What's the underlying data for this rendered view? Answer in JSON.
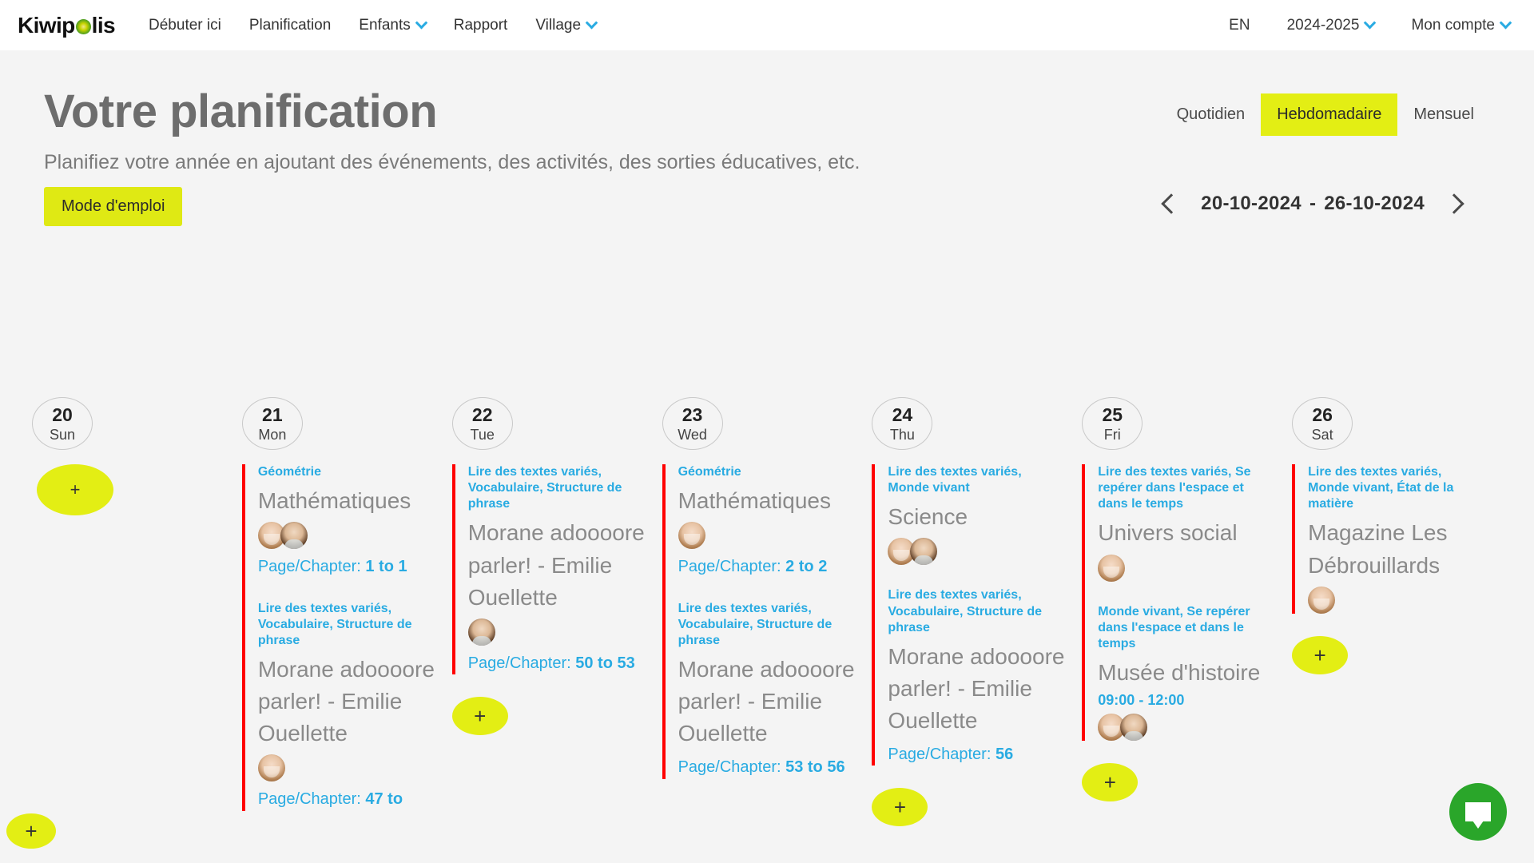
{
  "nav": {
    "brand_pre": "Kiwip",
    "brand_post": "lis",
    "links": [
      {
        "label": "Débuter ici",
        "caret": false
      },
      {
        "label": "Planification",
        "caret": false
      },
      {
        "label": "Enfants",
        "caret": true
      },
      {
        "label": "Rapport",
        "caret": false
      },
      {
        "label": "Village",
        "caret": true
      }
    ],
    "language": "EN",
    "school_year": "2024-2025",
    "account": "Mon compte"
  },
  "header": {
    "title": "Votre planification",
    "subtitle": "Planifiez votre année en ajoutant des événements, des activités, des sorties éducatives, etc.",
    "howto_button": "Mode d'emploi"
  },
  "view_tabs": [
    {
      "label": "Quotidien",
      "active": false
    },
    {
      "label": "Hebdomadaire",
      "active": true
    },
    {
      "label": "Mensuel",
      "active": false
    }
  ],
  "date_nav": {
    "start": "20-10-2024",
    "separator": "-",
    "end": "26-10-2024",
    "prev_label": "‹",
    "next_label": "›"
  },
  "add_label": "+",
  "colors": {
    "accent_yellow": "#e3ee14",
    "link_blue": "#29abe2",
    "event_bar_red": "#ff0000",
    "chat_green": "#2aa62a",
    "title_grey": "#6d6d6d"
  },
  "days": [
    {
      "num": "20",
      "name": "Sun",
      "events": [],
      "add_button": true
    },
    {
      "num": "21",
      "name": "Mon",
      "events": [
        {
          "tags": "Géométrie",
          "title": "Mathématiques",
          "avatars": [
            "girl",
            "boy"
          ],
          "page": "Page/Chapter: ",
          "page_value": "1 to 1",
          "time": ""
        },
        {
          "tags": "Lire des textes variés, Vocabulaire, Structure de phrase",
          "title": "Morane adoooore parler! - Emilie Ouellette",
          "avatars": [
            "girl"
          ],
          "page": "Page/Chapter: ",
          "page_value": "47 to",
          "time": ""
        }
      ],
      "add_button": false
    },
    {
      "num": "22",
      "name": "Tue",
      "events": [
        {
          "tags": "Lire des textes variés, Vocabulaire, Structure de phrase",
          "title": "Morane adoooore parler! - Emilie Ouellette",
          "avatars": [
            "boy"
          ],
          "page": "Page/Chapter: ",
          "page_value": "50 to 53",
          "time": ""
        }
      ],
      "add_button": true
    },
    {
      "num": "23",
      "name": "Wed",
      "events": [
        {
          "tags": "Géométrie",
          "title": "Mathématiques",
          "avatars": [
            "girl"
          ],
          "page": "Page/Chapter: ",
          "page_value": "2 to 2",
          "time": ""
        },
        {
          "tags": "Lire des textes variés, Vocabulaire, Structure de phrase",
          "title": "Morane adoooore parler! - Emilie Ouellette",
          "avatars": [],
          "page": "Page/Chapter: ",
          "page_value": "53 to 56",
          "time": ""
        }
      ],
      "add_button": false
    },
    {
      "num": "24",
      "name": "Thu",
      "events": [
        {
          "tags": "Lire des textes variés, Monde vivant",
          "title": "Science",
          "avatars": [
            "girl",
            "boy"
          ],
          "page": "",
          "page_value": "",
          "time": ""
        },
        {
          "tags": "Lire des textes variés, Vocabulaire, Structure de phrase",
          "title": "Morane adoooore parler! - Emilie Ouellette",
          "avatars": [],
          "page": "Page/Chapter: ",
          "page_value": "56",
          "time": ""
        }
      ],
      "add_button": true
    },
    {
      "num": "25",
      "name": "Fri",
      "events": [
        {
          "tags": "Lire des textes variés, Se repérer dans l'espace et dans le temps",
          "title": "Univers social",
          "avatars": [
            "girl"
          ],
          "page": "",
          "page_value": "",
          "time": ""
        },
        {
          "tags": "Monde vivant, Se repérer dans l'espace et dans le temps",
          "title": "Musée d'histoire",
          "avatars": [
            "girl",
            "boy"
          ],
          "page": "",
          "page_value": "",
          "time": "09:00 - 12:00"
        }
      ],
      "add_button": true
    },
    {
      "num": "26",
      "name": "Sat",
      "events": [
        {
          "tags": "Lire des textes variés, Monde vivant, État de la matière",
          "title": "Magazine Les Débrouillards",
          "avatars": [
            "girl"
          ],
          "page": "",
          "page_value": "",
          "time": ""
        }
      ],
      "add_button": true
    }
  ]
}
